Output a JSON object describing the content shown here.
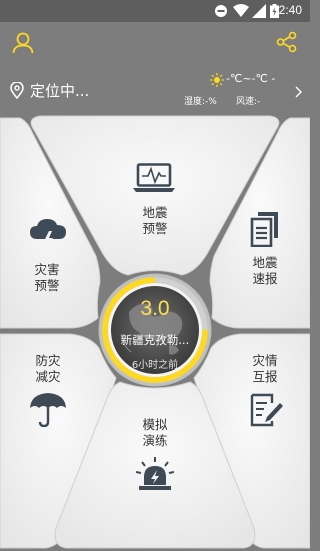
{
  "status_bar": {
    "time": "2:40"
  },
  "header": {
    "location": "定位中...",
    "weather": {
      "temperature": "-℃~-℃ -",
      "humidity": "湿度:-%",
      "wind": "风速:-"
    }
  },
  "menu": {
    "warning": [
      "地震",
      "预警"
    ],
    "disaster_warning": [
      "灾害",
      "预警"
    ],
    "quick_report": [
      "地震",
      "速报"
    ],
    "prevention": [
      "防灾",
      "减灾"
    ],
    "mutual_report": [
      "灾情",
      "互报"
    ],
    "drill": [
      "模拟",
      "演练"
    ]
  },
  "latest_quake": {
    "magnitude": "3.0",
    "place": "新疆克孜勒...",
    "time_ago": "6小时之前",
    "progress": 0.75
  },
  "colors": {
    "accent": "#ffd820",
    "background": "#7d7d7d",
    "tile": "#f1f1f1",
    "icon": "#3e4a56"
  }
}
